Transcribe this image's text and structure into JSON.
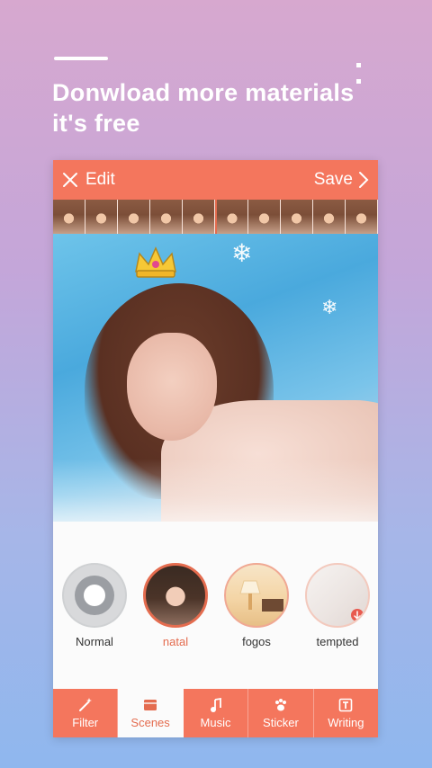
{
  "promo": {
    "headline_line1": "Donwload more materials",
    "headline_line2": "it's free"
  },
  "editor": {
    "edit_label": "Edit",
    "save_label": "Save"
  },
  "scenes": [
    {
      "name": "Normal",
      "selected": false
    },
    {
      "name": "natal",
      "selected": true
    },
    {
      "name": "fogos",
      "selected": false
    },
    {
      "name": "tempted",
      "selected": false
    }
  ],
  "tabs": [
    {
      "label": "Filter",
      "icon": "magic-wand-icon",
      "active": false
    },
    {
      "label": "Scenes",
      "icon": "scenes-icon",
      "active": true
    },
    {
      "label": "Music",
      "icon": "music-note-icon",
      "active": false
    },
    {
      "label": "Sticker",
      "icon": "paw-icon",
      "active": false
    },
    {
      "label": "Writing",
      "icon": "text-icon",
      "active": false
    }
  ],
  "colors": {
    "accent": "#f4765d",
    "accent_text": "#e46c4f",
    "panel": "#fbfbfb"
  }
}
